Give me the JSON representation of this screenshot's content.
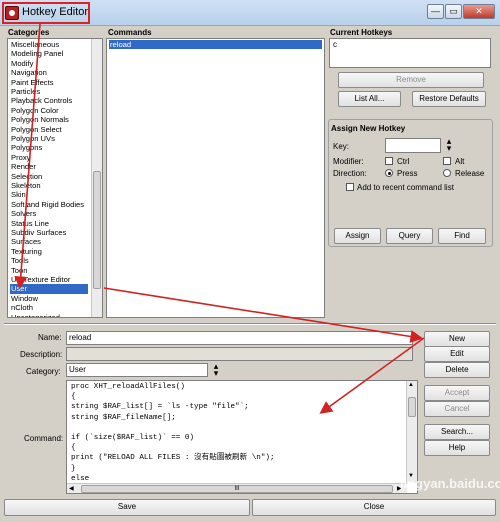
{
  "window": {
    "title": "Hotkey Editor",
    "min_glyph": "—",
    "max_glyph": "▭",
    "close_glyph": "✕"
  },
  "categories": {
    "header": "Categories",
    "items": [
      "Miscellaneous",
      "Modeling Panel",
      "Modify",
      "Navigation",
      "Paint Effects",
      "Particles",
      "Playback Controls",
      "Polygon Color",
      "Polygon Normals",
      "Polygon Select",
      "Polygon UVs",
      "Polygons",
      "Proxy",
      "Render",
      "Selection",
      "Skeleton",
      "Skin",
      "Soft and Rigid Bodies",
      "Solvers",
      "Status Line",
      "Subdiv Surfaces",
      "Surfaces",
      "Texturing",
      "Tools",
      "Toon",
      "UV Texture Editor",
      "User",
      "Window",
      "nCloth",
      "Uncategorized"
    ],
    "selected": "User"
  },
  "commands": {
    "header": "Commands",
    "items": [
      "reload"
    ],
    "selected": "reload"
  },
  "current_hotkeys": {
    "header": "Current Hotkeys",
    "value": "c",
    "remove_label": "Remove",
    "list_all_label": "List All...",
    "restore_label": "Restore Defaults"
  },
  "assign": {
    "header": "Assign New Hotkey",
    "key_label": "Key:",
    "key_value": "",
    "modifier_label": "Modifier:",
    "ctrl_label": "Ctrl",
    "alt_label": "Alt",
    "direction_label": "Direction:",
    "press_label": "Press",
    "release_label": "Release",
    "direction_value": "Press",
    "recent_label": "Add to recent command list",
    "assign_label": "Assign",
    "query_label": "Query",
    "find_label": "Find"
  },
  "form": {
    "name_label": "Name:",
    "name_value": "reload",
    "description_label": "Description:",
    "description_value": "",
    "category_label": "Category:",
    "category_value": "User",
    "command_label": "Command:",
    "code_lines": [
      "proc XHT_reloadAllFiles()",
      "{",
      "string $RAF_list[] = `ls -type \"file\"`;",
      "string $RAF_fileName[];",
      "",
      "if (`size($RAF_list)` == 0)",
      "{",
      "print (\"RELOAD ALL FILES : 沒有貼圖被刷新 \\n\");",
      "}",
      "else"
    ],
    "new_label": "New",
    "edit_label": "Edit",
    "delete_label": "Delete",
    "accept_label": "Accept",
    "cancel_label": "Cancel",
    "search_label": "Search...",
    "help_label": "Help",
    "hscroll_grip": "III"
  },
  "footer": {
    "save_label": "Save",
    "close_label": "Close"
  },
  "watermark": "jingyan.baidu.com",
  "colors": {
    "selection": "#3169c6",
    "arrow": "#d22222",
    "window_bg": "#d4d0c8"
  }
}
